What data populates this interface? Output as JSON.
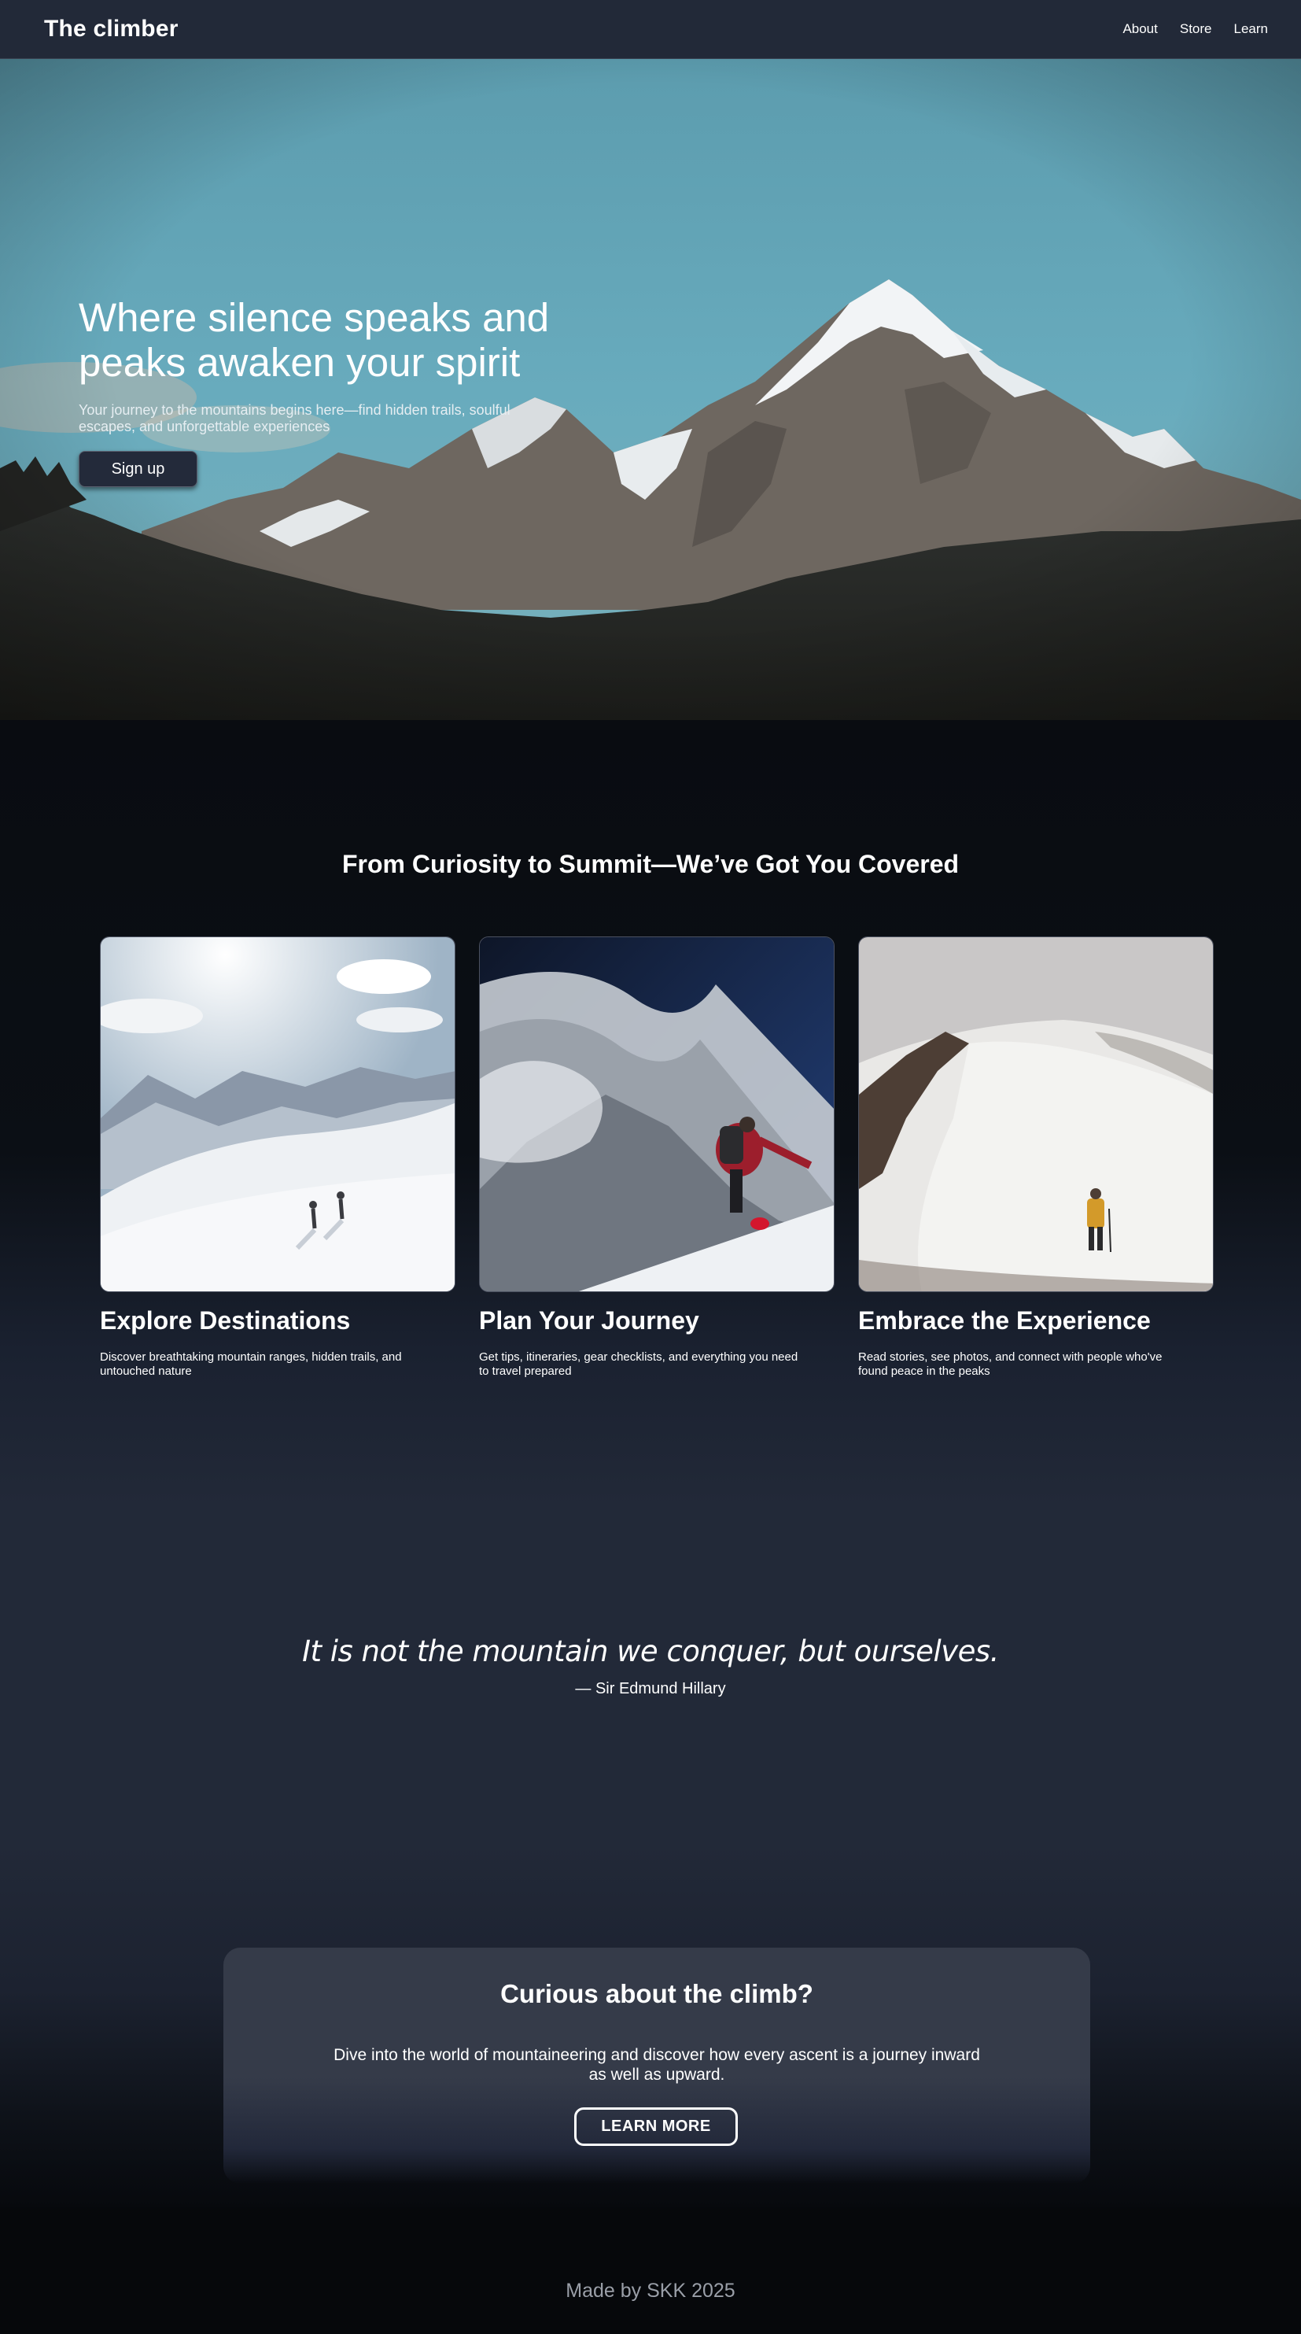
{
  "header": {
    "brand": "The climber",
    "nav": [
      {
        "label": "About"
      },
      {
        "label": "Store"
      },
      {
        "label": "Learn"
      }
    ]
  },
  "hero": {
    "title": "Where silence speaks and peaks awaken your spirit",
    "subtitle": "Your journey to the mountains begins here—find hidden trails, soulful escapes, and unforgettable experiences",
    "signup_label": "Sign up"
  },
  "features": {
    "title": "From Curiosity to Summit—We’ve Got You Covered",
    "cards": [
      {
        "title": "Explore Destinations",
        "desc": "Discover breathtaking mountain ranges, hidden trails, and untouched nature"
      },
      {
        "title": "Plan Your Journey",
        "desc": "Get tips, itineraries, gear checklists, and everything you need to travel prepared"
      },
      {
        "title": "Embrace the Experience",
        "desc": "Read stories, see photos, and connect with people who've found peace in the peaks"
      }
    ]
  },
  "quote": {
    "text": "It is not the mountain we conquer, but ourselves.",
    "author": "— Sir Edmund Hillary"
  },
  "cta": {
    "title": "Curious about the climb?",
    "text": "Dive into the world of mountaineering and discover how every ascent is a journey inward as well as upward.",
    "button_label": "LEARN MORE"
  },
  "footer": {
    "text": "Made by SKK 2025"
  },
  "colors": {
    "navbar": "#222938",
    "page_dark": "#0a0d12",
    "card_bg": "#353b49",
    "button_dark": "#232a3a"
  }
}
